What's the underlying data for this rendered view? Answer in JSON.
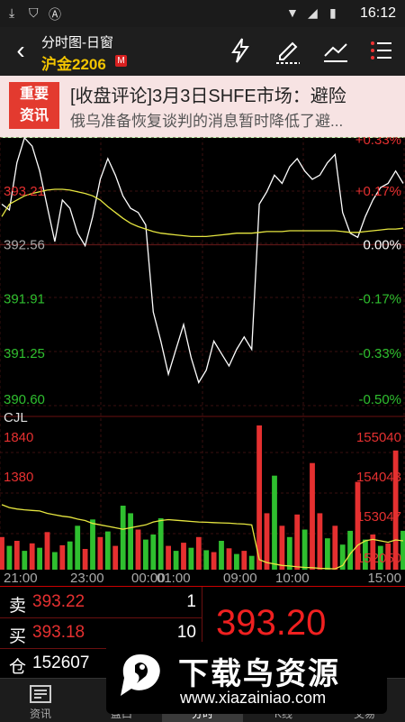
{
  "status_bar": {
    "time": "16:12",
    "icons": [
      "download-icon",
      "shield-icon",
      "a-icon",
      "wifi-icon",
      "signal-icon",
      "battery-icon"
    ]
  },
  "header": {
    "title": "分时图-日窗",
    "contract": "沪金2206",
    "badge": "M"
  },
  "toolbar": {
    "icons": [
      "lightning-icon",
      "draw-pen-icon",
      "trend-line-icon",
      "menu-list-icon"
    ]
  },
  "news": {
    "badge_line1": "重要",
    "badge_line2": "资讯",
    "headline": "[收盘评论]3月3日SHFE市场：避险",
    "summary": "俄乌准备恢复谈判的消息暂时降低了避..."
  },
  "quote": {
    "sell_label": "卖",
    "sell_price": "393.22",
    "sell_qty": "1",
    "buy_label": "买",
    "buy_price": "393.18",
    "buy_qty": "10",
    "oi_label": "仓",
    "open_interest": "152607",
    "last_price": "393.20"
  },
  "tabs": [
    {
      "label": "资讯",
      "icon": "news-icon"
    },
    {
      "label": "盘口",
      "icon": "order-book-icon"
    },
    {
      "label": "分时",
      "icon": "intraday-icon"
    },
    {
      "label": "K线",
      "icon": "candlestick-icon"
    },
    {
      "label": "交易",
      "icon": "trade-icon"
    }
  ],
  "watermark": {
    "title": "下载鸟资源",
    "url": "www.xiazainiao.com"
  },
  "colors": {
    "up": "#e53030",
    "down": "#2fbf2f",
    "avg_line": "#e6e640",
    "price_line": "#ffffff",
    "accent": "#f2c400"
  },
  "chart_data": {
    "type": "line",
    "title": "",
    "x_ticks": [
      "21:00",
      "23:00",
      "00:00",
      "01:00",
      "09:00",
      "10:00",
      "15:00"
    ],
    "y_ticks_price": [
      "393.21",
      "392.56",
      "391.91",
      "391.25",
      "390.60"
    ],
    "y_ticks_pct": [
      "+0.17%",
      "0.00%",
      "-0.17%",
      "-0.33%",
      "-0.50%"
    ],
    "pct_top_partial": "+0.33%",
    "ylim": [
      390.6,
      393.86
    ],
    "prev_settle": 392.56,
    "price_series": [
      393.05,
      392.98,
      393.55,
      393.85,
      393.75,
      393.45,
      393.02,
      392.6,
      393.1,
      393.0,
      392.7,
      392.55,
      392.9,
      393.35,
      393.6,
      393.4,
      393.15,
      393.0,
      392.95,
      392.8,
      391.75,
      391.4,
      391.0,
      391.3,
      391.6,
      391.2,
      390.9,
      391.05,
      391.4,
      391.25,
      391.1,
      391.3,
      391.45,
      391.3,
      393.05,
      393.2,
      393.4,
      393.3,
      393.5,
      393.6,
      393.45,
      393.35,
      393.4,
      393.55,
      393.65,
      392.95,
      392.7,
      392.65,
      392.9,
      393.1,
      393.25,
      393.3,
      393.45,
      393.3
    ],
    "avg_series": [
      392.9,
      393.05,
      393.1,
      393.15,
      393.18,
      393.2,
      393.22,
      393.23,
      393.23,
      393.22,
      393.2,
      393.18,
      393.15,
      393.1,
      393.02,
      392.95,
      392.88,
      392.82,
      392.78,
      392.75,
      392.72,
      392.7,
      392.69,
      392.68,
      392.67,
      392.66,
      392.66,
      392.66,
      392.67,
      392.68,
      392.69,
      392.7,
      392.7,
      392.7,
      392.71,
      392.72,
      392.72,
      392.72,
      392.73,
      392.73,
      392.73,
      392.73,
      392.73,
      392.73,
      392.73,
      392.72,
      392.71,
      392.71,
      392.72,
      392.73,
      392.74,
      392.75,
      392.75,
      392.76
    ],
    "volume_label": "CJL",
    "volume_ticks_left": [
      "1840",
      "1380"
    ],
    "volume_ticks_right": [
      "155040",
      "154043",
      "153047",
      "152050"
    ],
    "vol_max": 2300,
    "oi_range": [
      151053,
      156036
    ],
    "volume": [
      520,
      380,
      460,
      300,
      420,
      350,
      600,
      280,
      390,
      450,
      700,
      330,
      800,
      520,
      610,
      380,
      1020,
      900,
      640,
      480,
      560,
      820,
      380,
      300,
      430,
      350,
      520,
      310,
      280,
      460,
      340,
      250,
      300,
      220,
      2300,
      900,
      1500,
      700,
      520,
      880,
      640,
      1700,
      900,
      500,
      700,
      400,
      620,
      1400,
      480,
      560,
      380,
      420,
      1900,
      620
    ],
    "volume_dir": [
      "u",
      "d",
      "u",
      "d",
      "u",
      "d",
      "u",
      "d",
      "u",
      "d",
      "d",
      "u",
      "d",
      "u",
      "d",
      "u",
      "d",
      "d",
      "u",
      "d",
      "d",
      "d",
      "u",
      "d",
      "u",
      "d",
      "u",
      "d",
      "u",
      "d",
      "u",
      "d",
      "u",
      "d",
      "u",
      "u",
      "d",
      "u",
      "d",
      "u",
      "d",
      "u",
      "u",
      "d",
      "u",
      "d",
      "d",
      "u",
      "d",
      "u",
      "d",
      "u",
      "u",
      "d"
    ],
    "open_interest_series": [
      153300,
      153200,
      153150,
      153120,
      153100,
      153080,
      153000,
      152950,
      152900,
      152870,
      152800,
      152750,
      152650,
      152600,
      152550,
      152500,
      152450,
      152500,
      152550,
      152600,
      152700,
      152750,
      152780,
      152760,
      152740,
      152720,
      152700,
      152690,
      152680,
      152670,
      152660,
      152640,
      152630,
      152600,
      151400,
      151300,
      151250,
      151200,
      151180,
      151150,
      151130,
      151120,
      151100,
      151090,
      151080,
      151200,
      151600,
      151900,
      152050,
      152100,
      152050,
      152000,
      152080,
      152050
    ]
  }
}
